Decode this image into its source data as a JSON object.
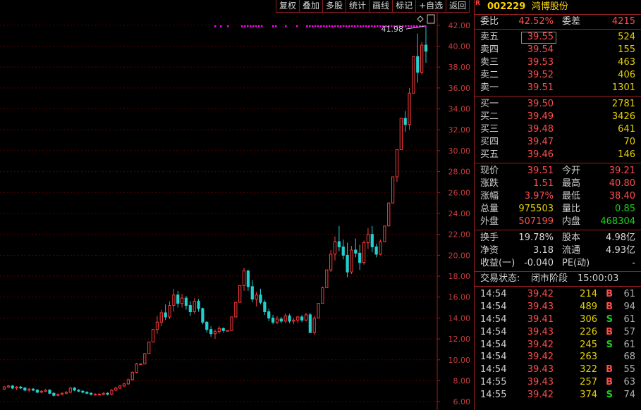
{
  "toolbar": [
    "复权",
    "叠加",
    "多股",
    "统计",
    "画线",
    "标记",
    "+自选",
    "返回"
  ],
  "chart": {
    "y_ticks": [
      "42.00",
      "40.00",
      "38.00",
      "36.00",
      "34.00",
      "32.00",
      "30.00",
      "28.00",
      "26.00",
      "24.00",
      "22.00",
      "20.00",
      "18.00",
      "16.00",
      "14.00",
      "12.00",
      "10.00",
      "8.00",
      "6.00"
    ],
    "high_label": "41.98",
    "colors": {
      "up": "#ff3b3b",
      "down": "#22d0d0",
      "grid": "#5a0000",
      "axis": "#a01e1e",
      "label": "#c83c3c",
      "marker": "#ff00ff"
    }
  },
  "chart_data": {
    "type": "candlestick",
    "ylim": [
      5.2,
      43.2
    ],
    "candles": [
      [
        7.2,
        7.5,
        7.1,
        7.4
      ],
      [
        7.4,
        7.6,
        7.3,
        7.5
      ],
      [
        7.5,
        7.6,
        7.2,
        7.3
      ],
      [
        7.3,
        7.5,
        7.1,
        7.4
      ],
      [
        7.4,
        7.5,
        7.2,
        7.3
      ],
      [
        7.3,
        7.4,
        7.0,
        7.1
      ],
      [
        7.1,
        7.3,
        6.9,
        7.2
      ],
      [
        7.2,
        7.3,
        7.0,
        7.1
      ],
      [
        7.1,
        7.2,
        6.8,
        6.9
      ],
      [
        6.9,
        7.1,
        6.8,
        7.0
      ],
      [
        7.0,
        7.2,
        6.9,
        7.1
      ],
      [
        7.1,
        7.2,
        6.7,
        6.8
      ],
      [
        6.8,
        6.9,
        6.5,
        6.6
      ],
      [
        6.6,
        6.8,
        6.5,
        6.7
      ],
      [
        6.7,
        6.9,
        6.6,
        6.8
      ],
      [
        6.8,
        7.0,
        6.7,
        6.9
      ],
      [
        6.9,
        7.4,
        6.8,
        7.3
      ],
      [
        7.3,
        7.4,
        7.0,
        7.1
      ],
      [
        7.1,
        7.2,
        6.9,
        7.0
      ],
      [
        7.0,
        7.1,
        6.8,
        6.9
      ],
      [
        6.9,
        7.0,
        6.7,
        6.8
      ],
      [
        6.8,
        6.9,
        6.6,
        6.7
      ],
      [
        6.7,
        6.8,
        6.6,
        6.7
      ],
      [
        6.7,
        6.8,
        6.6,
        6.7
      ],
      [
        6.7,
        6.9,
        6.6,
        6.8
      ],
      [
        6.8,
        6.9,
        6.6,
        6.7
      ],
      [
        6.7,
        7.2,
        6.6,
        7.1
      ],
      [
        7.1,
        7.4,
        7.0,
        7.3
      ],
      [
        7.3,
        7.6,
        7.2,
        7.5
      ],
      [
        7.5,
        7.8,
        7.4,
        7.7
      ],
      [
        7.7,
        8.2,
        7.6,
        8.1
      ],
      [
        8.1,
        8.9,
        8.0,
        8.8
      ],
      [
        8.8,
        9.7,
        8.7,
        9.6
      ],
      [
        9.6,
        9.6,
        9.6,
        9.6
      ],
      [
        9.6,
        10.6,
        9.6,
        10.6
      ],
      [
        10.6,
        11.7,
        10.6,
        11.7
      ],
      [
        11.7,
        12.9,
        11.7,
        12.9
      ],
      [
        12.9,
        14.2,
        12.5,
        13.6
      ],
      [
        13.6,
        14.8,
        13.2,
        14.5
      ],
      [
        14.5,
        15.3,
        13.8,
        14.1
      ],
      [
        14.1,
        15.6,
        13.9,
        15.2
      ],
      [
        15.2,
        16.8,
        14.6,
        16.2
      ],
      [
        16.2,
        16.6,
        15.0,
        15.4
      ],
      [
        15.4,
        16.3,
        15.0,
        15.9
      ],
      [
        15.9,
        16.1,
        14.8,
        15.2
      ],
      [
        15.2,
        15.6,
        14.2,
        14.6
      ],
      [
        14.6,
        15.9,
        14.4,
        15.6
      ],
      [
        15.6,
        15.8,
        14.6,
        14.9
      ],
      [
        14.9,
        15.0,
        13.4,
        13.6
      ],
      [
        13.6,
        13.7,
        12.6,
        12.9
      ],
      [
        12.9,
        13.2,
        12.2,
        12.5
      ],
      [
        12.5,
        12.9,
        12.0,
        12.7
      ],
      [
        12.7,
        13.2,
        12.5,
        13.0
      ],
      [
        13.0,
        13.1,
        12.6,
        12.8
      ],
      [
        12.8,
        12.8,
        12.8,
        12.8
      ],
      [
        12.8,
        14.1,
        12.8,
        14.1
      ],
      [
        14.1,
        15.5,
        14.1,
        15.5
      ],
      [
        15.5,
        17.1,
        15.5,
        17.1
      ],
      [
        17.1,
        18.8,
        16.6,
        18.5
      ],
      [
        18.5,
        18.6,
        16.6,
        17.0
      ],
      [
        17.0,
        17.6,
        15.5,
        15.8
      ],
      [
        15.8,
        16.5,
        15.1,
        16.2
      ],
      [
        16.2,
        16.8,
        15.3,
        15.5
      ],
      [
        15.5,
        15.7,
        14.3,
        14.6
      ],
      [
        14.6,
        14.9,
        13.7,
        14.0
      ],
      [
        14.0,
        14.3,
        13.4,
        13.6
      ],
      [
        13.6,
        14.2,
        13.4,
        13.9
      ],
      [
        13.9,
        14.1,
        13.5,
        13.7
      ],
      [
        13.7,
        14.4,
        13.5,
        14.2
      ],
      [
        14.2,
        14.4,
        13.5,
        13.7
      ],
      [
        13.7,
        14.0,
        13.4,
        13.8
      ],
      [
        13.8,
        14.2,
        13.5,
        14.1
      ],
      [
        14.1,
        14.3,
        13.6,
        13.8
      ],
      [
        13.8,
        14.5,
        13.7,
        14.3
      ],
      [
        14.3,
        14.5,
        13.1,
        12.6
      ],
      [
        12.6,
        14.2,
        12.4,
        14.0
      ],
      [
        14.0,
        15.4,
        14.0,
        15.4
      ],
      [
        15.4,
        17.0,
        15.4,
        16.9
      ],
      [
        16.9,
        18.6,
        16.9,
        18.6
      ],
      [
        18.6,
        20.5,
        18.4,
        20.1
      ],
      [
        20.1,
        21.8,
        19.5,
        21.3
      ],
      [
        21.3,
        22.8,
        20.4,
        20.8
      ],
      [
        20.8,
        21.5,
        19.6,
        20.0
      ],
      [
        20.0,
        21.2,
        17.9,
        18.4
      ],
      [
        18.4,
        20.9,
        18.2,
        20.5
      ],
      [
        20.5,
        21.6,
        19.8,
        20.2
      ],
      [
        20.2,
        21.0,
        18.6,
        19.3
      ],
      [
        19.3,
        21.4,
        19.1,
        21.2
      ],
      [
        21.2,
        22.6,
        20.6,
        22.0
      ],
      [
        22.0,
        22.8,
        20.3,
        20.8
      ],
      [
        20.8,
        21.1,
        19.8,
        20.1
      ],
      [
        20.1,
        21.5,
        20.0,
        21.3
      ],
      [
        21.3,
        22.8,
        21.3,
        22.8
      ],
      [
        22.8,
        25.0,
        22.8,
        25.0
      ],
      [
        25.0,
        27.5,
        25.0,
        27.5
      ],
      [
        27.5,
        30.1,
        27.0,
        30.1
      ],
      [
        30.1,
        33.1,
        30.1,
        33.1
      ],
      [
        33.1,
        33.8,
        31.8,
        32.5
      ],
      [
        32.5,
        36.0,
        32.0,
        35.5
      ],
      [
        35.5,
        39.0,
        35.5,
        39.0
      ],
      [
        39.0,
        41.2,
        36.5,
        37.5
      ],
      [
        37.5,
        40.4,
        37.3,
        40.1
      ],
      [
        40.1,
        41.98,
        38.4,
        39.51
      ]
    ],
    "markers": [
      null,
      null,
      null,
      null,
      null,
      null,
      null,
      null,
      null,
      null,
      null,
      null,
      null,
      null,
      null,
      null,
      null,
      null,
      null,
      null,
      null,
      null,
      null,
      null,
      null,
      null,
      null,
      null,
      null,
      null,
      null,
      null,
      null,
      null,
      null,
      null,
      null,
      null,
      null,
      null,
      null,
      null,
      null,
      null,
      null,
      null,
      null,
      null,
      null,
      null,
      null,
      null,
      null,
      null,
      null,
      null,
      null,
      null,
      null,
      null,
      null,
      null,
      null,
      null,
      null,
      null,
      null,
      null,
      null,
      null,
      null,
      null,
      null,
      null,
      null,
      null,
      null,
      null,
      null,
      null,
      null,
      null,
      null,
      null,
      null,
      null,
      null,
      null,
      null,
      null,
      null,
      null,
      null,
      null,
      null,
      null,
      null,
      null,
      null,
      null,
      null,
      null,
      null
    ]
  },
  "quote": {
    "code": "002229",
    "name": "鸿博股份",
    "r": "R",
    "weibi_label": "委比",
    "weibi": "42.52%",
    "weicha_label": "委差",
    "weicha": "4215",
    "sell": [
      {
        "label": "卖五",
        "price": "39.55",
        "vol": "524"
      },
      {
        "label": "卖四",
        "price": "39.54",
        "vol": "155"
      },
      {
        "label": "卖三",
        "price": "39.53",
        "vol": "463"
      },
      {
        "label": "卖二",
        "price": "39.52",
        "vol": "406"
      },
      {
        "label": "卖一",
        "price": "39.51",
        "vol": "1301"
      }
    ],
    "buy": [
      {
        "label": "买一",
        "price": "39.50",
        "vol": "2781"
      },
      {
        "label": "买二",
        "price": "39.49",
        "vol": "3426"
      },
      {
        "label": "买三",
        "price": "39.48",
        "vol": "641"
      },
      {
        "label": "买四",
        "price": "39.47",
        "vol": "70"
      },
      {
        "label": "买五",
        "price": "39.46",
        "vol": "146"
      }
    ],
    "stats1": [
      {
        "l1": "现价",
        "v1": "39.51",
        "c1": "red",
        "l2": "今开",
        "v2": "39.21",
        "c2": "red"
      },
      {
        "l1": "涨跌",
        "v1": "1.51",
        "c1": "red",
        "l2": "最高",
        "v2": "40.80",
        "c2": "red"
      },
      {
        "l1": "涨幅",
        "v1": "3.97%",
        "c1": "red",
        "l2": "最低",
        "v2": "38.40",
        "c2": "red"
      },
      {
        "l1": "总量",
        "v1": "975503",
        "c1": "yellow",
        "l2": "量比",
        "v2": "0.85",
        "c2": "green"
      },
      {
        "l1": "外盘",
        "v1": "507199",
        "c1": "red",
        "l2": "内盘",
        "v2": "468304",
        "c2": "green"
      }
    ],
    "stats2": [
      {
        "l1": "换手",
        "v1": "19.78%",
        "c1": "white",
        "l2": "股本",
        "v2": "4.98亿",
        "c2": "white"
      },
      {
        "l1": "净资",
        "v1": "3.18",
        "c1": "white",
        "l2": "流通",
        "v2": "4.93亿",
        "c2": "white"
      },
      {
        "l1": "收益(一)",
        "v1": "-0.040",
        "c1": "white",
        "l2": "PE(动)",
        "v2": "-",
        "c2": "white"
      }
    ],
    "status_label": "交易状态:",
    "status_value": "闭市阶段",
    "status_time": "15:00:03",
    "trades": [
      {
        "t": "14:54",
        "p": "39.42",
        "v": "214",
        "bs": "B",
        "n": "61"
      },
      {
        "t": "14:54",
        "p": "39.43",
        "v": "489",
        "bs": "B",
        "n": "94"
      },
      {
        "t": "14:54",
        "p": "39.41",
        "v": "306",
        "bs": "S",
        "n": "61"
      },
      {
        "t": "14:54",
        "p": "39.43",
        "v": "226",
        "bs": "B",
        "n": "57"
      },
      {
        "t": "14:54",
        "p": "39.42",
        "v": "245",
        "bs": "S",
        "n": "61"
      },
      {
        "t": "14:54",
        "p": "39.42",
        "v": "263",
        "bs": "",
        "n": "68"
      },
      {
        "t": "14:54",
        "p": "39.43",
        "v": "322",
        "bs": "B",
        "n": "55"
      },
      {
        "t": "14:55",
        "p": "39.43",
        "v": "257",
        "bs": "B",
        "n": "63"
      },
      {
        "t": "14:55",
        "p": "39.42",
        "v": "374",
        "bs": "S",
        "n": "74"
      }
    ]
  }
}
